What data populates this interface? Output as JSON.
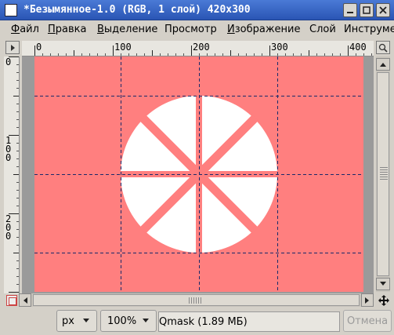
{
  "window": {
    "title": "*Безымянное-1.0 (RGB, 1 слой) 420x300"
  },
  "menu": {
    "items": [
      {
        "underline": "Ф",
        "rest": "айл"
      },
      {
        "underline": "П",
        "rest": "равка"
      },
      {
        "underline": "В",
        "rest": "ыделение"
      },
      {
        "underline": "",
        "rest": "Просмотр"
      },
      {
        "underline": "И",
        "rest": "зображение"
      },
      {
        "underline": "",
        "rest": "Слой"
      },
      {
        "underline": "",
        "rest": "Инструме"
      }
    ]
  },
  "rulers": {
    "top_labels": [
      "0",
      "100",
      "200",
      "300",
      "400"
    ],
    "left_labels": [
      "0",
      "100",
      "200"
    ]
  },
  "canvas": {
    "background_color": "#ff7f7f",
    "circle_color": "#ffffff",
    "guide_color": "#1a2a6a"
  },
  "statusbar": {
    "unit": "px",
    "zoom": "100%",
    "message": "Qmask (1.89 МБ)",
    "cancel_label": "Отмена"
  },
  "icons": {
    "app": "gimp-image-icon",
    "ruler_corner": "triangle-right-icon",
    "zoom_fit": "zoom-icon",
    "navigate": "navigate-cross-icon",
    "quick_mask": "quick-mask-icon"
  }
}
